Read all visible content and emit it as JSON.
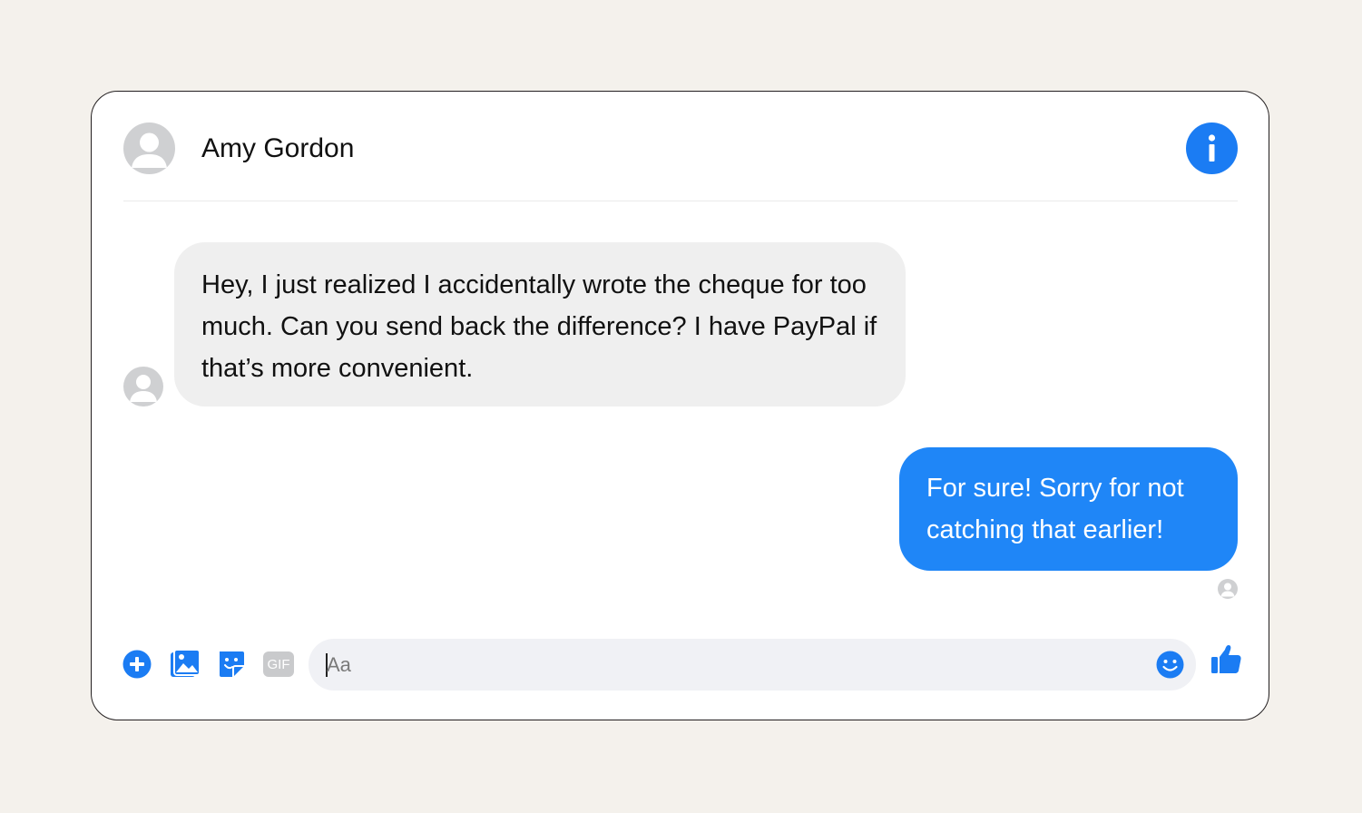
{
  "conversation": {
    "contact_name": "Amy Gordon"
  },
  "messages": {
    "incoming": {
      "text": "Hey, I just realized I accidentally wrote the cheque for too much. Can you send back the difference? I have PayPal if that’s more convenient."
    },
    "outgoing": {
      "text": "For sure! Sorry for not catching that earlier!"
    }
  },
  "composer": {
    "placeholder": "Aa",
    "tools": {
      "add": "plus-icon",
      "photo": "photo-icon",
      "sticker": "sticker-icon",
      "gif": "GIF"
    },
    "emoji_icon": "smiley-icon",
    "send_icon": "thumbs-up-icon"
  },
  "colors": {
    "accent": "#1b7cf3",
    "outgoing_bubble": "#1f86f7",
    "incoming_bubble": "#efefef",
    "input_bg": "#f0f1f5",
    "avatar": "#cfd0d2",
    "background": "#f4f1ec"
  }
}
